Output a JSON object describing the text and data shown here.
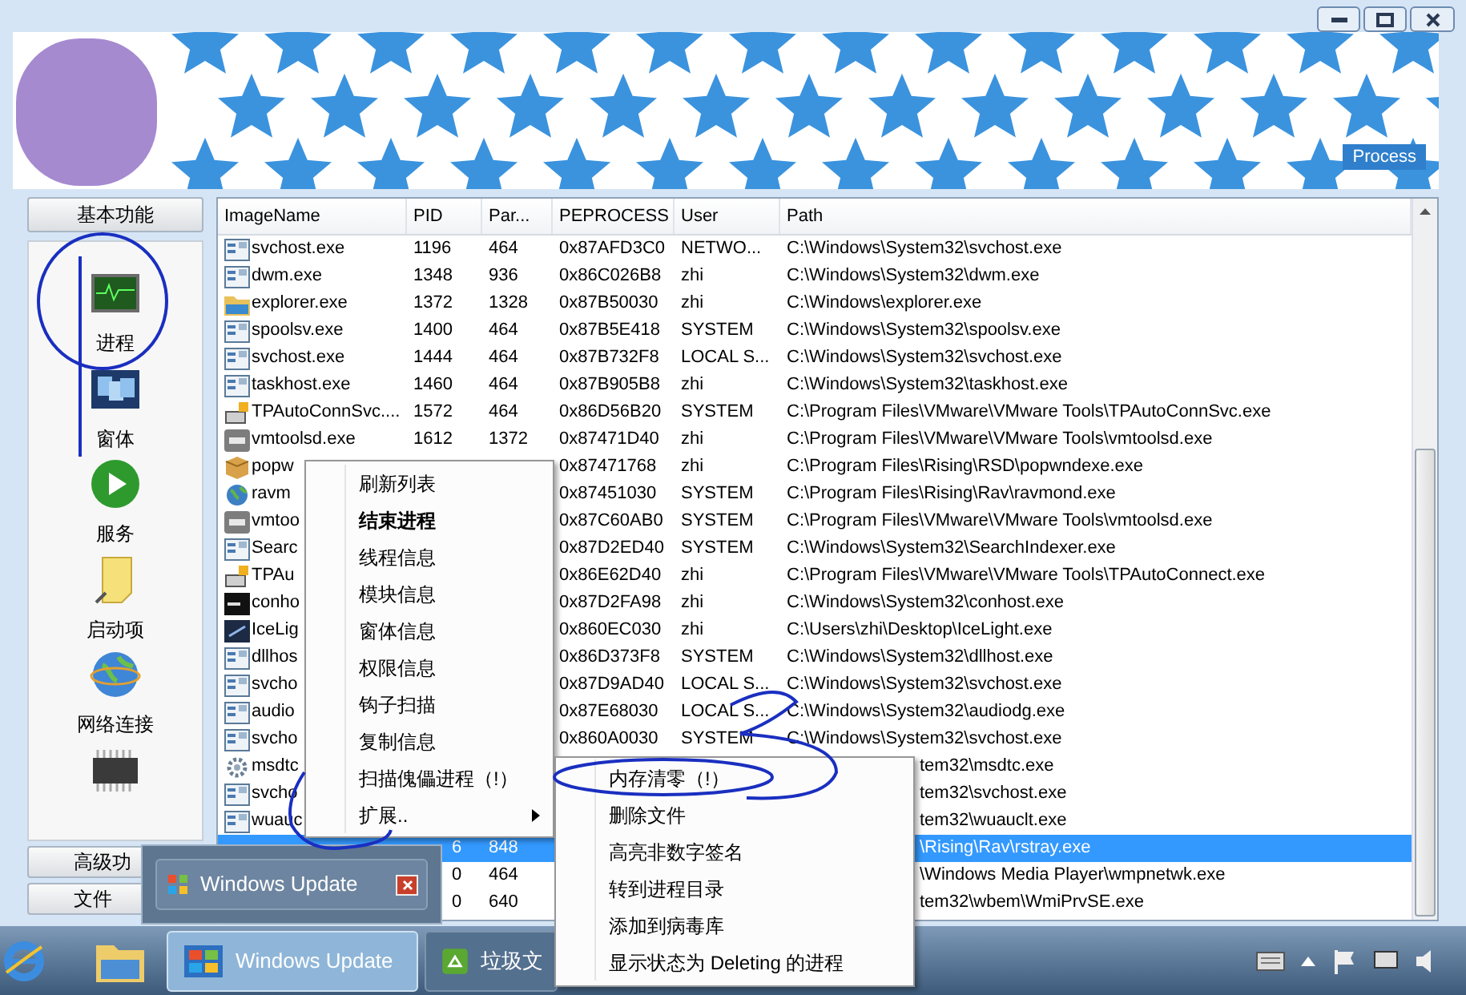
{
  "banner": {
    "label": "Process"
  },
  "sidebar": {
    "top_button": "基本功能",
    "items": [
      {
        "kind": "monitor",
        "label": "进程"
      },
      {
        "kind": "windows",
        "label": "窗体"
      },
      {
        "kind": "play",
        "label": "服务"
      },
      {
        "kind": "note",
        "label": "启动项"
      },
      {
        "kind": "globe",
        "label": "网络连接"
      },
      {
        "kind": "chip"
      }
    ],
    "bottom_buttons": [
      "高级功",
      "文件"
    ]
  },
  "table": {
    "columns": [
      "ImageName",
      "PID",
      "Par...",
      "PEPROCESS",
      "User",
      "Path"
    ],
    "rows": [
      {
        "kind": "app",
        "selected": false,
        "name": "svchost.exe",
        "pid": "1196",
        "parent": "464",
        "peprocess": "0x87AFD3C0",
        "user": "NETWO...",
        "path": "C:\\Windows\\System32\\svchost.exe"
      },
      {
        "kind": "app",
        "selected": false,
        "name": "dwm.exe",
        "pid": "1348",
        "parent": "936",
        "peprocess": "0x86C026B8",
        "user": "zhi",
        "path": "C:\\Windows\\System32\\dwm.exe"
      },
      {
        "kind": "folder",
        "selected": false,
        "name": "explorer.exe",
        "pid": "1372",
        "parent": "1328",
        "peprocess": "0x87B50030",
        "user": "zhi",
        "path": "C:\\Windows\\explorer.exe"
      },
      {
        "kind": "app",
        "selected": false,
        "name": "spoolsv.exe",
        "pid": "1400",
        "parent": "464",
        "peprocess": "0x87B5E418",
        "user": "SYSTEM",
        "path": "C:\\Windows\\System32\\spoolsv.exe"
      },
      {
        "kind": "app",
        "selected": false,
        "name": "svchost.exe",
        "pid": "1444",
        "parent": "464",
        "peprocess": "0x87B732F8",
        "user": "LOCAL S...",
        "path": "C:\\Windows\\System32\\svchost.exe"
      },
      {
        "kind": "app",
        "selected": false,
        "name": "taskhost.exe",
        "pid": "1460",
        "parent": "464",
        "peprocess": "0x87B905B8",
        "user": "zhi",
        "path": "C:\\Windows\\System32\\taskhost.exe"
      },
      {
        "kind": "tp",
        "selected": false,
        "name": "TPAutoConnSvc....",
        "pid": "1572",
        "parent": "464",
        "peprocess": "0x86D56B20",
        "user": "SYSTEM",
        "path": "C:\\Program Files\\VMware\\VMware Tools\\TPAutoConnSvc.exe"
      },
      {
        "kind": "vm",
        "selected": false,
        "name": "vmtoolsd.exe",
        "pid": "1612",
        "parent": "1372",
        "peprocess": "0x87471D40",
        "user": "zhi",
        "path": "C:\\Program Files\\VMware\\VMware Tools\\vmtoolsd.exe"
      },
      {
        "kind": "box",
        "selected": false,
        "name": "popw",
        "peprocess": "0x87471768",
        "user": "zhi",
        "path": "C:\\Program Files\\Rising\\RSD\\popwndexe.exe"
      },
      {
        "kind": "globe",
        "selected": false,
        "name": "ravm",
        "peprocess": "0x87451030",
        "user": "SYSTEM",
        "path": "C:\\Program Files\\Rising\\Rav\\ravmond.exe"
      },
      {
        "kind": "vm",
        "selected": false,
        "name": "vmtoo",
        "peprocess": "0x87C60AB0",
        "user": "SYSTEM",
        "path": "C:\\Program Files\\VMware\\VMware Tools\\vmtoolsd.exe"
      },
      {
        "kind": "app",
        "selected": false,
        "name": "Searc",
        "peprocess": "0x87D2ED40",
        "user": "SYSTEM",
        "path": "C:\\Windows\\System32\\SearchIndexer.exe"
      },
      {
        "kind": "tp",
        "selected": false,
        "name": "TPAu",
        "peprocess": "0x86E62D40",
        "user": "zhi",
        "path": "C:\\Program Files\\VMware\\VMware Tools\\TPAutoConnect.exe"
      },
      {
        "kind": "console",
        "selected": false,
        "name": "conho",
        "peprocess": "0x87D2FA98",
        "user": "zhi",
        "path": "C:\\Windows\\System32\\conhost.exe"
      },
      {
        "kind": "dark",
        "selected": false,
        "name": "IceLig",
        "peprocess": "0x860EC030",
        "user": "zhi",
        "path": "C:\\Users\\zhi\\Desktop\\IceLight.exe"
      },
      {
        "kind": "app",
        "selected": false,
        "name": "dllhos",
        "peprocess": "0x86D373F8",
        "user": "SYSTEM",
        "path": "C:\\Windows\\System32\\dllhost.exe"
      },
      {
        "kind": "app",
        "selected": false,
        "name": "svcho",
        "peprocess": "0x87D9AD40",
        "user": "LOCAL S...",
        "path": "C:\\Windows\\System32\\svchost.exe"
      },
      {
        "kind": "app",
        "selected": false,
        "name": "audio",
        "peprocess": "0x87E68030",
        "user": "LOCAL S...",
        "path": "C:\\Windows\\System32\\audiodg.exe"
      },
      {
        "kind": "app",
        "selected": false,
        "name": "svcho",
        "peprocess": "0x860A0030",
        "user": "SYSTEM",
        "path": "C:\\Windows\\System32\\svchost.exe"
      },
      {
        "kind": "gear",
        "selected": false,
        "name": "msdtc",
        "path": "tem32\\msdtc.exe"
      },
      {
        "kind": "app",
        "selected": false,
        "name": "svcho",
        "path": "tem32\\svchost.exe"
      },
      {
        "kind": "app",
        "selected": false,
        "name": "wuauc",
        "path": "tem32\\wuauclt.exe"
      },
      {
        "selected": true,
        "pid": "6",
        "parent": "848",
        "path": "\\Rising\\Rav\\rstray.exe"
      },
      {
        "selected": false,
        "pid": "0",
        "parent": "464",
        "path": "\\Windows Media Player\\wmpnetwk.exe"
      },
      {
        "selected": false,
        "pid": "0",
        "parent": "640",
        "path": "tem32\\wbem\\WmiPrvSE.exe"
      }
    ]
  },
  "context_menu": {
    "items": [
      {
        "label": "刷新列表",
        "default": false,
        "submenu": false
      },
      {
        "label": "结束进程",
        "default": true,
        "submenu": false
      },
      {
        "label": "线程信息",
        "default": false,
        "submenu": false
      },
      {
        "label": "模块信息",
        "default": false,
        "submenu": false
      },
      {
        "label": "窗体信息",
        "default": false,
        "submenu": false
      },
      {
        "label": "权限信息",
        "default": false,
        "submenu": false
      },
      {
        "label": "钩子扫描",
        "default": false,
        "submenu": false
      },
      {
        "label": "复制信息",
        "default": false,
        "submenu": false
      },
      {
        "label": "扫描傀儡进程（!）",
        "default": false,
        "submenu": false
      },
      {
        "label": "扩展..",
        "default": false,
        "submenu": true
      }
    ]
  },
  "submenu": {
    "items": [
      "内存清零（!）",
      "删除文件",
      "高亮非数字签名",
      "转到进程目录",
      "添加到病毒库",
      "显示状态为 Deleting 的进程"
    ]
  },
  "taskbar_preview": {
    "title": "Windows Update"
  },
  "taskbar": {
    "buttons": [
      {
        "kind": "update",
        "label": "Windows Update",
        "selected": true
      },
      {
        "kind": "recycle",
        "label": "垃圾文",
        "selected": false
      }
    ]
  }
}
